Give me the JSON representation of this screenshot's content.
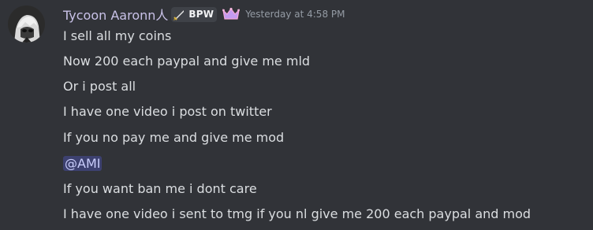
{
  "author": {
    "name": "Tycoon Aaronn人",
    "tag": {
      "icon": "sword-icon",
      "text": "BPW"
    },
    "badge_icon": "crown-icon",
    "timestamp": "Yesterday at 4:58 PM"
  },
  "messages": [
    "I sell all my coins",
    "Now 200 each paypal and give me mld",
    "Or i post all",
    "I have one video i post on twitter",
    "If you no pay me and give me mod",
    "@AMI",
    "If you want ban me i dont care",
    "I have one video i sent to tmg if you nl give me 200 each paypal and mod"
  ],
  "colors": {
    "background": "#313338",
    "username": "#c9c2e8",
    "text": "#dbdee1",
    "timestamp": "#949ba4",
    "mention_bg": "#3c4270",
    "mention_text": "#c9cdfb"
  }
}
